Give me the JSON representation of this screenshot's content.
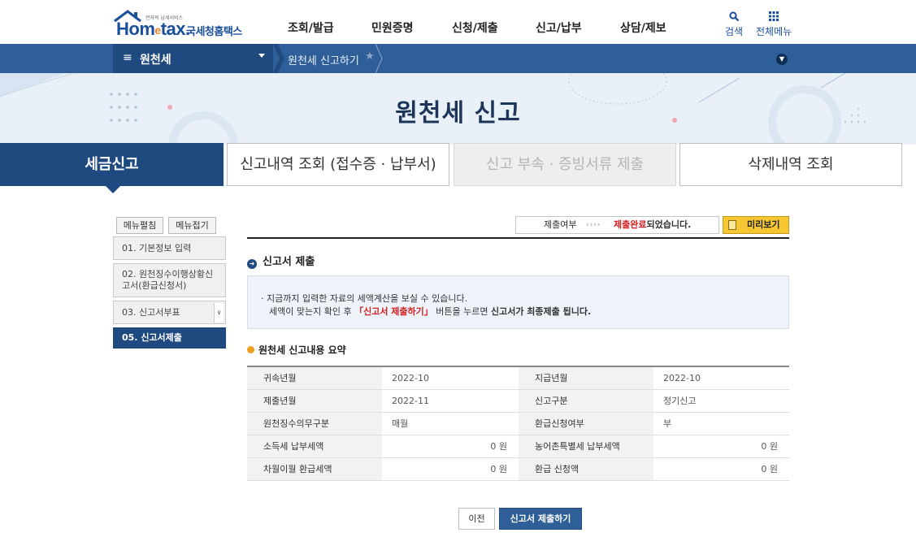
{
  "header": {
    "logo_word": "Hometax",
    "logo_tag": "전자적 납세서비스",
    "logo_sub": "국세청홈택스",
    "nav": [
      "조회/발급",
      "민원증명",
      "신청/제출",
      "신고/납부",
      "상담/제보"
    ],
    "search_label": "검색",
    "all_menu_label": "전체메뉴"
  },
  "navbar": {
    "menu_label": "원천세",
    "breadcrumb": "원천세 신고하기"
  },
  "banner": {
    "title": "원천세 신고"
  },
  "tabs": [
    "세금신고",
    "신고내역 조회 (접수증 · 납부서)",
    "신고 부속 · 증빙서류 제출",
    "삭제내역 조회"
  ],
  "sidebar": {
    "expand_label": "메뉴펼침",
    "collapse_label": "메뉴접기",
    "items": [
      {
        "label": "01. 기본정보 입력"
      },
      {
        "label": "02. 원천징수이행상황신고서(환급신청서)"
      },
      {
        "label": "03. 신고서부표"
      },
      {
        "label": "05. 신고서제출"
      }
    ]
  },
  "status": {
    "key": "제출여부",
    "arrows": "››››",
    "value_red": "제출완료",
    "value_rest": "되었습니다.",
    "preview_label": "미리보기"
  },
  "section": {
    "title": "신고서 제출",
    "info_line1": "· 지금까지 입력한 자료의 세액계산을 보실 수 있습니다.",
    "info_line2_a": "세액이 맞는지 확인 후 ",
    "info_line2_red": "「신고서 제출하기」",
    "info_line2_b": " 버튼을 누르면 ",
    "info_line2_bold": "신고서가 최종제출 됩니다."
  },
  "summary": {
    "title": "원천세 신고내용 요약",
    "rows": [
      {
        "k1": "귀속년월",
        "v1": "2022-10",
        "k2": "지급년월",
        "v2": "2022-10"
      },
      {
        "k1": "제출년월",
        "v1": "2022-11",
        "k2": "신고구분",
        "v2": "정기신고"
      },
      {
        "k1": "원천징수의무구분",
        "v1": "매월",
        "k2": "환급신청여부",
        "v2": "부"
      },
      {
        "k1": "소득세 납부세액",
        "v1": "0 원",
        "k2": "농어촌특별세 납부세액",
        "v2": "0 원"
      },
      {
        "k1": "차월이월 환급세액",
        "v1": "0 원",
        "k2": "환급 신청액",
        "v2": "0 원"
      }
    ]
  },
  "buttons": {
    "prev": "이전",
    "submit": "신고서 제출하기"
  },
  "colors": {
    "brand": "#1f4a80",
    "navbar": "#2f5f99",
    "accent_red": "#d11d1d",
    "preview": "#f6c633"
  }
}
